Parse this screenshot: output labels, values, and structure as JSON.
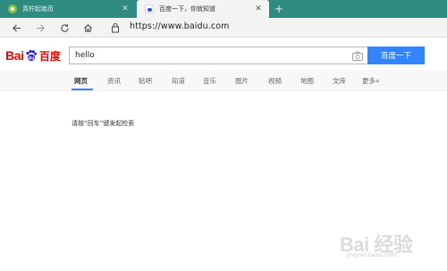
{
  "browser": {
    "tabs": [
      {
        "title": "青柠起始页",
        "active": false,
        "favicon": "qingning-icon"
      },
      {
        "title": "百度一下，你就知道",
        "active": true,
        "favicon": "baidu-paw-icon"
      }
    ],
    "close_glyph": "✕",
    "new_tab_glyph": "+",
    "url": "https://www.baidu.com"
  },
  "page": {
    "logo": {
      "bai": "Bai",
      "du": "du",
      "cn": "百度"
    },
    "search": {
      "value": "hello",
      "button_label": "百度一下"
    },
    "nav_tabs": [
      "网页",
      "资讯",
      "贴吧",
      "知道",
      "音乐",
      "图片",
      "视频",
      "地图",
      "文库",
      "更多»"
    ],
    "hint": "请按“回车”键发起检索"
  },
  "watermark": {
    "text": "Bai 经验",
    "subtext": "jingyan.baidu.com"
  },
  "colors": {
    "tab_strip": "#2f8a7f",
    "accent_blue": "#3385ff",
    "baidu_red": "#e10602",
    "baidu_blue": "#2319dc"
  }
}
